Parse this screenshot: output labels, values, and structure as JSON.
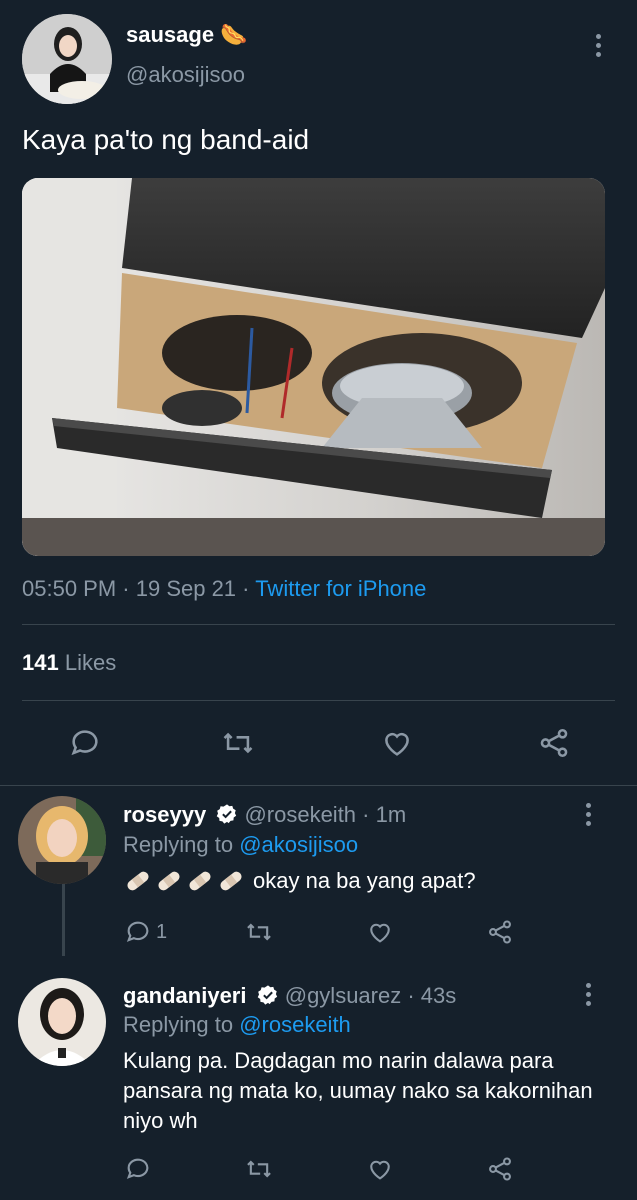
{
  "tweet": {
    "display_name": "sausage",
    "name_emoji": "🌭",
    "handle": "@akosijisoo",
    "text": "Kaya pa'to ng band-aid",
    "time": "05:50 PM",
    "date_sep": " · ",
    "date": "19 Sep 21",
    "source_sep": " · ",
    "source": "Twitter for iPhone",
    "likes_count": "141",
    "likes_label": "Likes"
  },
  "replies": [
    {
      "display_name": "roseyyy",
      "handle": "@rosekeith",
      "time": "1m",
      "replying_prefix": "Replying to ",
      "replying_to": "@akosijisoo",
      "text": "okay na ba yang apat?",
      "reply_count": "1"
    },
    {
      "display_name": "gandaniyeri",
      "handle": "@gylsuarez",
      "time": "43s",
      "replying_prefix": "Replying to ",
      "replying_to": "@rosekeith",
      "text": "Kulang pa. Dagdagan mo narin dalawa para pansara ng mata ko, uumay nako sa kakornihan niyo wh",
      "reply_count": ""
    }
  ],
  "sep": " · ",
  "colors": {
    "background": "#15202b",
    "text": "#ffffff",
    "muted": "#8b98a5",
    "accent": "#1d9bf0",
    "divider": "#38444d"
  },
  "icons": [
    "more-icon",
    "reply-icon",
    "retweet-icon",
    "like-icon",
    "share-icon",
    "verified-icon",
    "bandage-icon"
  ]
}
